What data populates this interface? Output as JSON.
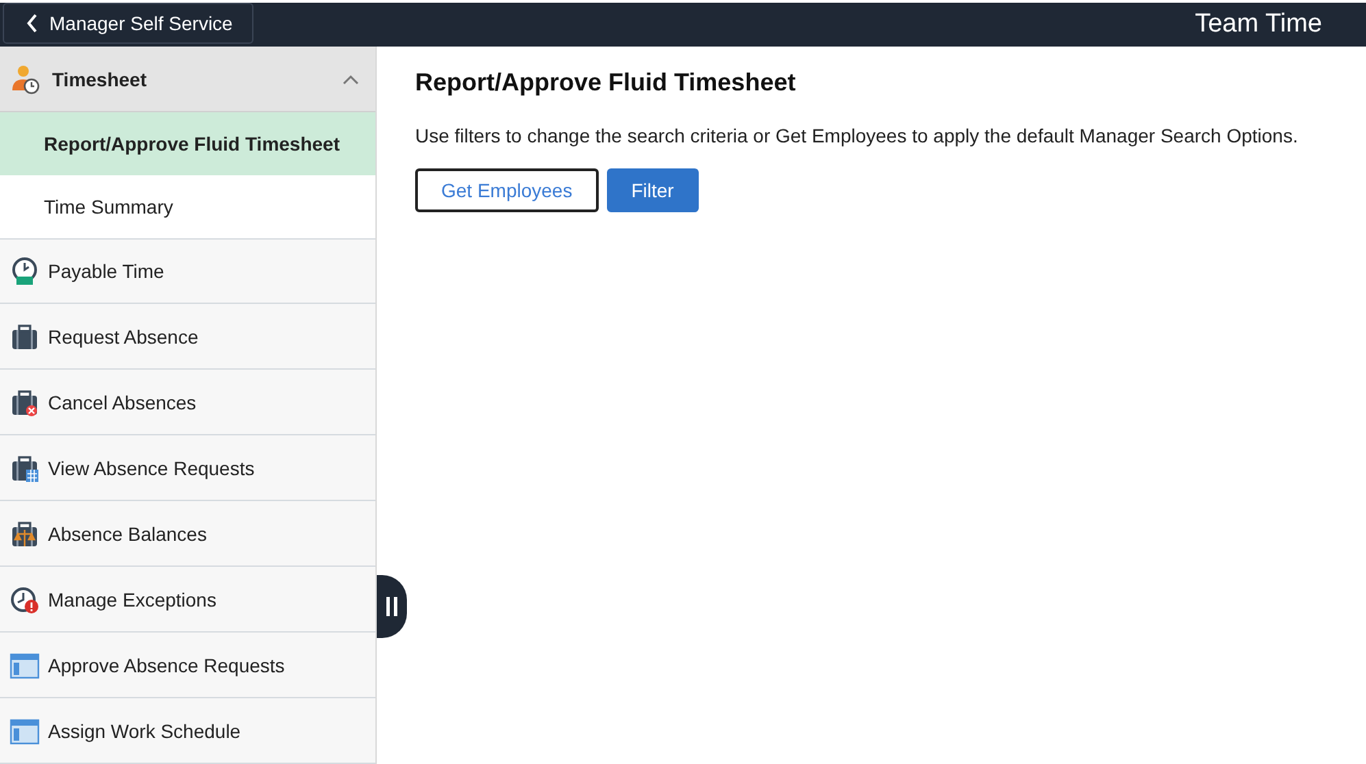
{
  "header": {
    "back_label": "Manager Self Service",
    "title": "Team Time"
  },
  "sidebar": {
    "group": {
      "label": "Timesheet",
      "expanded": true,
      "children": [
        {
          "label": "Report/Approve Fluid Timesheet",
          "selected": true
        },
        {
          "label": "Time Summary",
          "selected": false
        }
      ]
    },
    "items": [
      {
        "label": "Payable Time",
        "kind": "clock-money"
      },
      {
        "label": "Request Absence",
        "kind": "briefcase"
      },
      {
        "label": "Cancel Absences",
        "kind": "briefcase-cancel"
      },
      {
        "label": "View Absence Requests",
        "kind": "briefcase-calendar"
      },
      {
        "label": "Absence Balances",
        "kind": "briefcase-scale"
      },
      {
        "label": "Manage Exceptions",
        "kind": "clock-alert"
      },
      {
        "label": "Approve Absence Requests",
        "kind": "window"
      },
      {
        "label": "Assign Work Schedule",
        "kind": "window"
      }
    ]
  },
  "content": {
    "title": "Report/Approve Fluid Timesheet",
    "description": "Use filters to change the search criteria or Get Employees to apply the default Manager Search Options.",
    "buttons": [
      {
        "label": "Get Employees",
        "kind": "secondary"
      },
      {
        "label": "Filter",
        "kind": "primary"
      }
    ]
  }
}
